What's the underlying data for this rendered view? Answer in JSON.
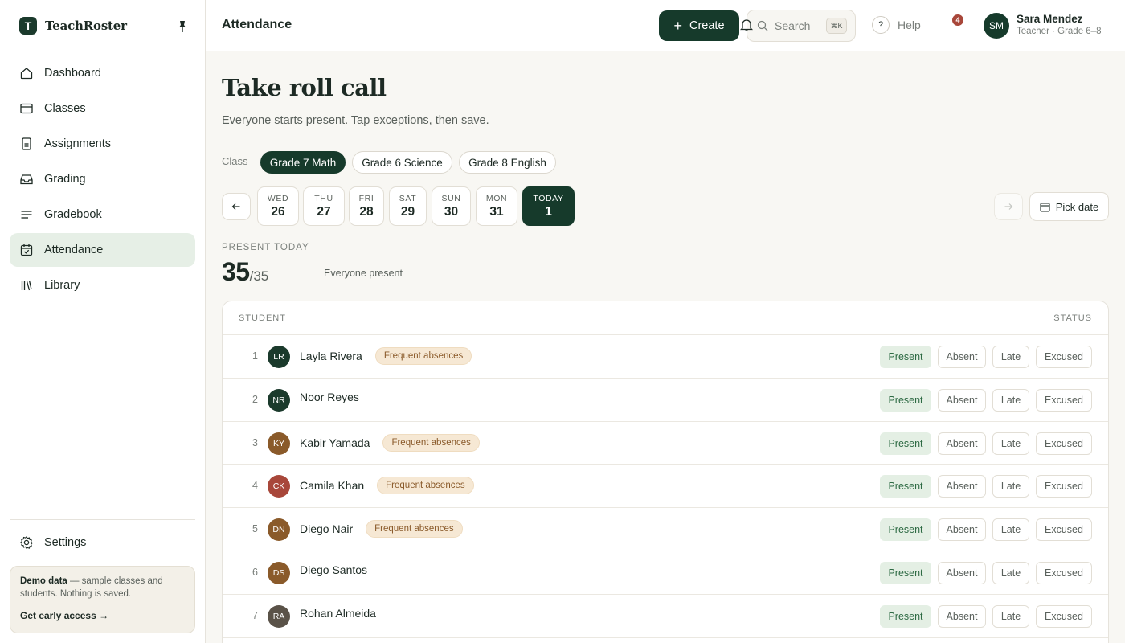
{
  "brand": {
    "name": "TeachRoster",
    "logo_letter": "T"
  },
  "sidebar": {
    "items": [
      {
        "label": "Dashboard",
        "icon": "home-icon",
        "active": false
      },
      {
        "label": "Classes",
        "icon": "classes-icon",
        "active": false
      },
      {
        "label": "Assignments",
        "icon": "assignments-icon",
        "active": false
      },
      {
        "label": "Grading",
        "icon": "grading-icon",
        "active": false
      },
      {
        "label": "Gradebook",
        "icon": "gradebook-icon",
        "active": false
      },
      {
        "label": "Attendance",
        "icon": "calendar-check-icon",
        "active": true
      },
      {
        "label": "Library",
        "icon": "library-icon",
        "active": false
      }
    ],
    "settings_label": "Settings",
    "demo": {
      "title": "Demo data",
      "text": " — sample classes and students. Nothing is saved.",
      "link": "Get early access →"
    }
  },
  "header": {
    "title": "Attendance",
    "create_label": "Create",
    "search_placeholder": "Search",
    "search_shortcut": "⌘K",
    "help_label": "Help",
    "notification_count": "4",
    "user": {
      "initials": "SM",
      "name": "Sara Mendez",
      "role": "Teacher · Grade 6–8"
    }
  },
  "main": {
    "title": "Take roll call",
    "subtitle": "Everyone starts present. Tap exceptions, then save.",
    "class_label": "Class",
    "classes": [
      {
        "label": "Grade 7 Math",
        "active": true
      },
      {
        "label": "Grade 6 Science",
        "active": false
      },
      {
        "label": "Grade 8 English",
        "active": false
      }
    ],
    "days": [
      {
        "dow": "WED",
        "num": "26",
        "active": false
      },
      {
        "dow": "THU",
        "num": "27",
        "active": false
      },
      {
        "dow": "FRI",
        "num": "28",
        "active": false
      },
      {
        "dow": "SAT",
        "num": "29",
        "active": false
      },
      {
        "dow": "SUN",
        "num": "30",
        "active": false
      },
      {
        "dow": "MON",
        "num": "31",
        "active": false
      },
      {
        "dow": "TODAY",
        "num": "1",
        "active": true
      }
    ],
    "pick_date_label": "Pick date",
    "present_label": "PRESENT TODAY",
    "present_count": "35",
    "present_total": "/35",
    "present_note": "Everyone present"
  },
  "table": {
    "col_student": "STUDENT",
    "col_status": "STATUS",
    "status_options": [
      "Present",
      "Absent",
      "Late",
      "Excused"
    ],
    "rows": [
      {
        "num": "1",
        "initials": "LR",
        "name": "Layla Rivera",
        "badge": "Frequent absences",
        "color": "#1b3a2c",
        "status": "Present"
      },
      {
        "num": "2",
        "initials": "NR",
        "name": "Noor Reyes",
        "badge": "",
        "color": "#1b3a2c",
        "status": "Present"
      },
      {
        "num": "3",
        "initials": "KY",
        "name": "Kabir Yamada",
        "badge": "Frequent absences",
        "color": "#8a5a2a",
        "status": "Present"
      },
      {
        "num": "4",
        "initials": "CK",
        "name": "Camila Khan",
        "badge": "Frequent absences",
        "color": "#a8473a",
        "status": "Present"
      },
      {
        "num": "5",
        "initials": "DN",
        "name": "Diego Nair",
        "badge": "Frequent absences",
        "color": "#8a5a2a",
        "status": "Present"
      },
      {
        "num": "6",
        "initials": "DS",
        "name": "Diego Santos",
        "badge": "",
        "color": "#8a5a2a",
        "status": "Present"
      },
      {
        "num": "7",
        "initials": "RA",
        "name": "Rohan Almeida",
        "badge": "",
        "color": "#5a5248",
        "status": "Present"
      }
    ]
  }
}
